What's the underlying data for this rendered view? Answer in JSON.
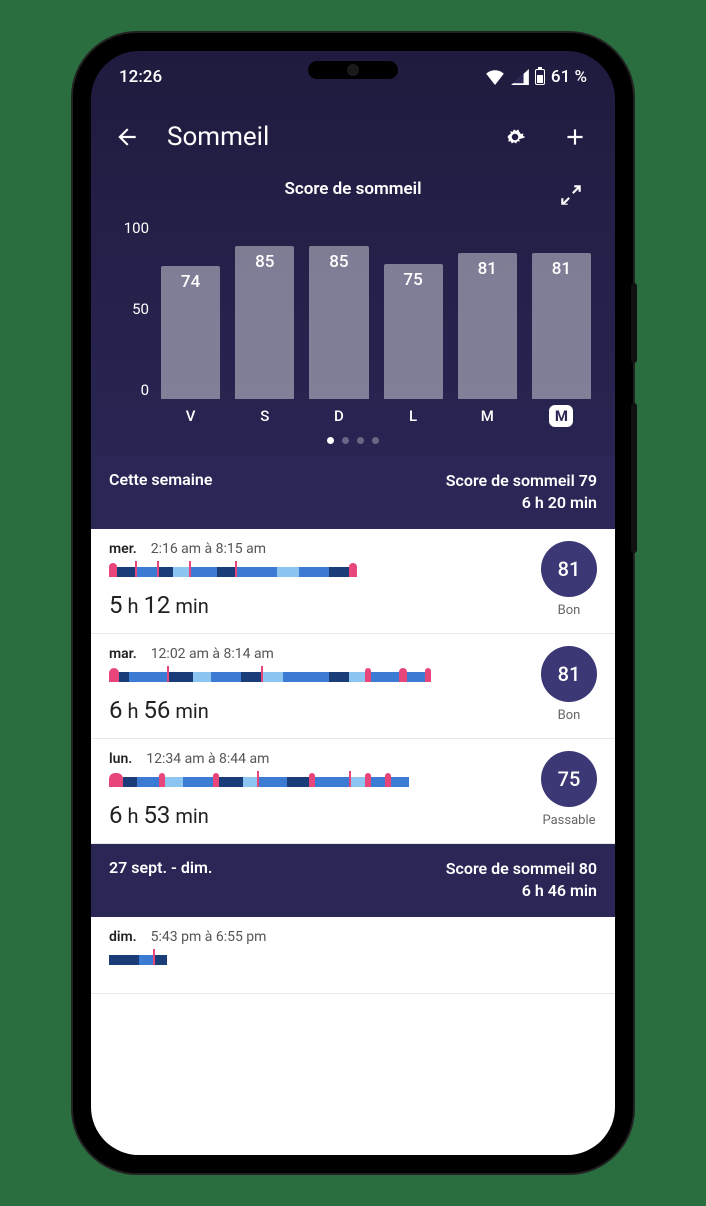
{
  "status": {
    "time": "12:26",
    "battery": "61 %"
  },
  "appbar": {
    "title": "Sommeil"
  },
  "chart_data": {
    "type": "bar",
    "title": "Score de sommeil",
    "categories": [
      "V",
      "S",
      "D",
      "L",
      "M",
      "M"
    ],
    "values": [
      74,
      85,
      85,
      75,
      81,
      81
    ],
    "ylabel": "",
    "ylim": [
      0,
      100
    ],
    "yticks": [
      "100",
      "50",
      "0"
    ],
    "selected_index": 5
  },
  "pager": {
    "count": 4,
    "active": 0
  },
  "week_summary": {
    "current": {
      "label": "Cette semaine",
      "score_label": "Score de sommeil 79",
      "duration": "6 h 20 min"
    },
    "previous": {
      "label": "27 sept. - dim.",
      "score_label": "Score de sommeil 80",
      "duration": "6 h 46 min"
    }
  },
  "entries": [
    {
      "day": "mer.",
      "range": "2:16 am à 8:15 am",
      "duration_h": "5",
      "duration_m": "12",
      "score": "81",
      "quality": "Bon"
    },
    {
      "day": "mar.",
      "range": "12:02 am à 8:14 am",
      "duration_h": "6",
      "duration_m": "56",
      "score": "81",
      "quality": "Bon"
    },
    {
      "day": "lun.",
      "range": "12:34 am à 8:44 am",
      "duration_h": "6",
      "duration_m": "53",
      "score": "75",
      "quality": "Passable"
    }
  ],
  "partial_entry": {
    "day": "dim.",
    "range": "5:43 pm à 6:55 pm"
  },
  "labels": {
    "h": "h",
    "min": "min"
  }
}
